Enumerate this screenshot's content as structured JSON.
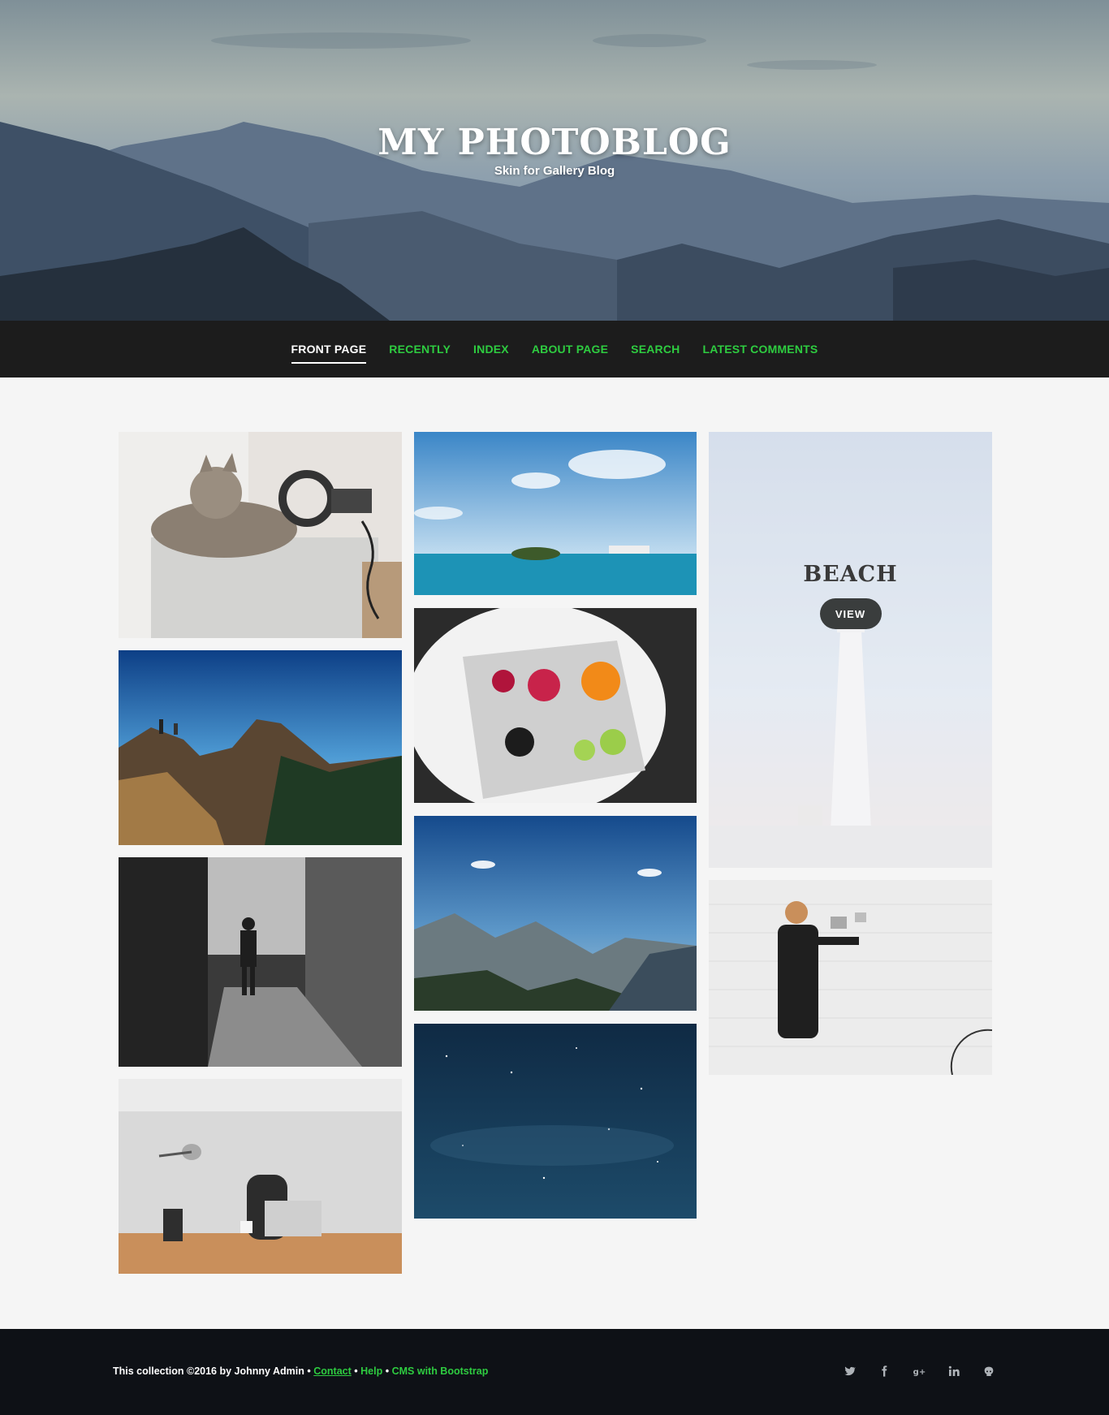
{
  "site": {
    "title": "MY PHOTOBLOG",
    "subtitle": "Skin for Gallery Blog"
  },
  "nav": {
    "items": [
      {
        "label": "FRONT PAGE",
        "active": true
      },
      {
        "label": "RECENTLY",
        "active": false
      },
      {
        "label": "INDEX",
        "active": false
      },
      {
        "label": "ABOUT PAGE",
        "active": false
      },
      {
        "label": "SEARCH",
        "active": false
      },
      {
        "label": "LATEST COMMENTS",
        "active": false
      }
    ]
  },
  "gallery": {
    "tiles": [
      {
        "name": "cat-headphones-photo",
        "column": 1
      },
      {
        "name": "hikers-mountain-photo",
        "column": 1
      },
      {
        "name": "alley-walker-photo",
        "column": 1
      },
      {
        "name": "desk-laptop-photo",
        "column": 1
      },
      {
        "name": "sea-boat-photo",
        "column": 2
      },
      {
        "name": "fruit-plate-photo",
        "column": 2
      },
      {
        "name": "mountain-valley-photo",
        "column": 2
      },
      {
        "name": "starry-sky-photo",
        "column": 2
      },
      {
        "name": "lighthouse-photo",
        "column": 3
      },
      {
        "name": "man-wall-photo",
        "column": 3
      }
    ],
    "featured": {
      "title": "BEACH",
      "button_label": "VIEW"
    }
  },
  "footer": {
    "copyright": "This collection ©2016 by Johnny Admin",
    "separator": "•",
    "links": [
      "Contact",
      "Help",
      "CMS with Bootstrap"
    ],
    "social_icons": [
      "twitter-icon",
      "facebook-icon",
      "google-plus-icon",
      "linkedin-icon",
      "github-icon"
    ]
  },
  "colors": {
    "accent": "#2ecc40",
    "nav_bg": "#1c1c1c",
    "footer_bg": "#0e1116",
    "page_bg": "#f5f5f5"
  }
}
